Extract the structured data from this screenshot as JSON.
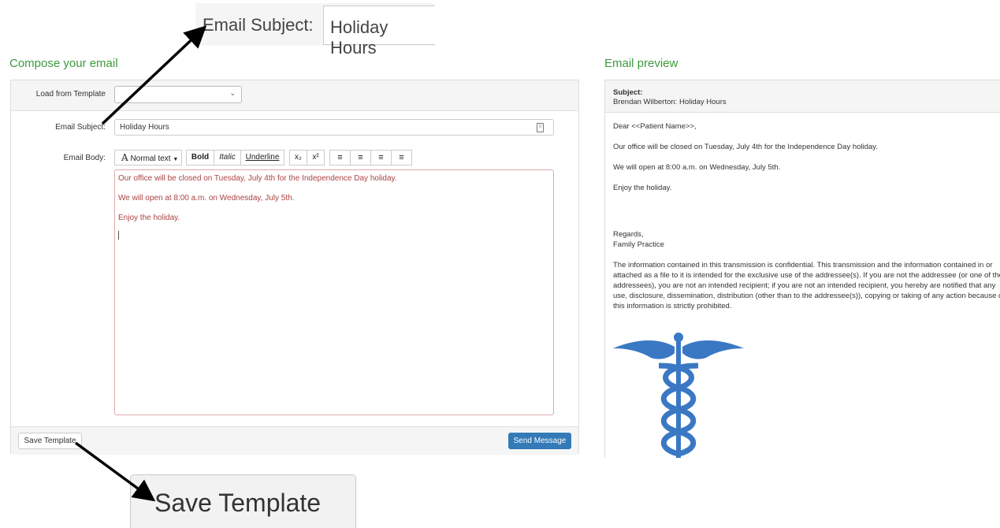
{
  "zoom_callouts": {
    "subject_label": "Email Subject:",
    "subject_value": "Holiday Hours",
    "save_button": "Save Template"
  },
  "compose": {
    "title": "Compose your email",
    "template_label": "Load from Template",
    "template_value": "",
    "subject_label": "Email Subject:",
    "subject_value": "Holiday Hours",
    "body_label": "Email Body:",
    "toolbar": {
      "format": "Normal text",
      "bold": "Bold",
      "italic": "Italic",
      "underline": "Underline",
      "subscript": "x₂",
      "superscript": "x²"
    },
    "body_lines": [
      "Our office will be closed on Tuesday, July 4th for the Independence Day holiday.",
      "We will open at 8:00 a.m. on Wednesday, July 5th.",
      "Enjoy the holiday."
    ],
    "save_template": "Save Template",
    "send_message": "Send Message"
  },
  "preview": {
    "title": "Email preview",
    "subject_label": "Subject:",
    "subject_value": "Brendan Wilberton: Holiday Hours",
    "greeting": "Dear <<Patient Name>>,",
    "lines": [
      "Our office will be closed on Tuesday, July 4th for the Independence Day holiday.",
      "We will open at 8:00 a.m. on Wednesday, July 5th.",
      "Enjoy the holiday."
    ],
    "regards": "Regards,",
    "signature": "Family Practice",
    "disclaimer": "The information contained in this transmission is confidential. This transmission and the information contained in or attached as a file to it is intended for the exclusive use of the addressee(s). If you are not the addressee (or one of the addressees), you are not an intended recipient; if you are not an intended recipient, you hereby are notified that any use, disclosure, dissemination, distribution (other than to the addressee(s)), copying or taking of any action because of this information is strictly prohibited."
  },
  "colors": {
    "section_title": "#3c9a3c",
    "primary_button": "#337ab7",
    "body_text": "#a94442",
    "caduceus": "#3a78c4"
  }
}
